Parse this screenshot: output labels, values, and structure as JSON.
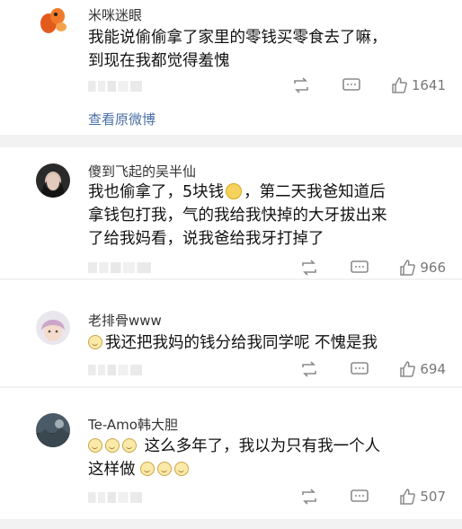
{
  "comments": [
    {
      "username": "米咪迷眼",
      "lines": [
        "我能说偷偷拿了家里的零钱买零食去了嘛，",
        "到现在我都觉得羞愧"
      ],
      "likes": "1641",
      "view_original": "查看原微博"
    },
    {
      "username": "傻到飞起的吴半仙",
      "line1_pre": "我也偷拿了，5块钱",
      "line1_post": "，第二天我爸知道后",
      "line2": "拿钱包打我，气的我给我快掉的大牙拔出来",
      "line3": "了给我妈看，说我爸给我牙打掉了",
      "likes": "966"
    },
    {
      "username": "老排骨www",
      "text": "我还把我妈的钱分给我同学呢 不愧是我",
      "likes": "694"
    },
    {
      "username": "Te-Amo韩大胆",
      "line1": "这么多年了，我以为只有我一个人",
      "line2": "这样做",
      "likes": "507"
    }
  ],
  "icons": {
    "repost": "repost-icon",
    "comment": "comment-icon",
    "like": "thumbs-up-icon",
    "emoji": "smile-emoji-icon"
  },
  "colors": {
    "link": "#4a6fa5",
    "separator": "#f2f2f2",
    "meta": "#777777"
  }
}
